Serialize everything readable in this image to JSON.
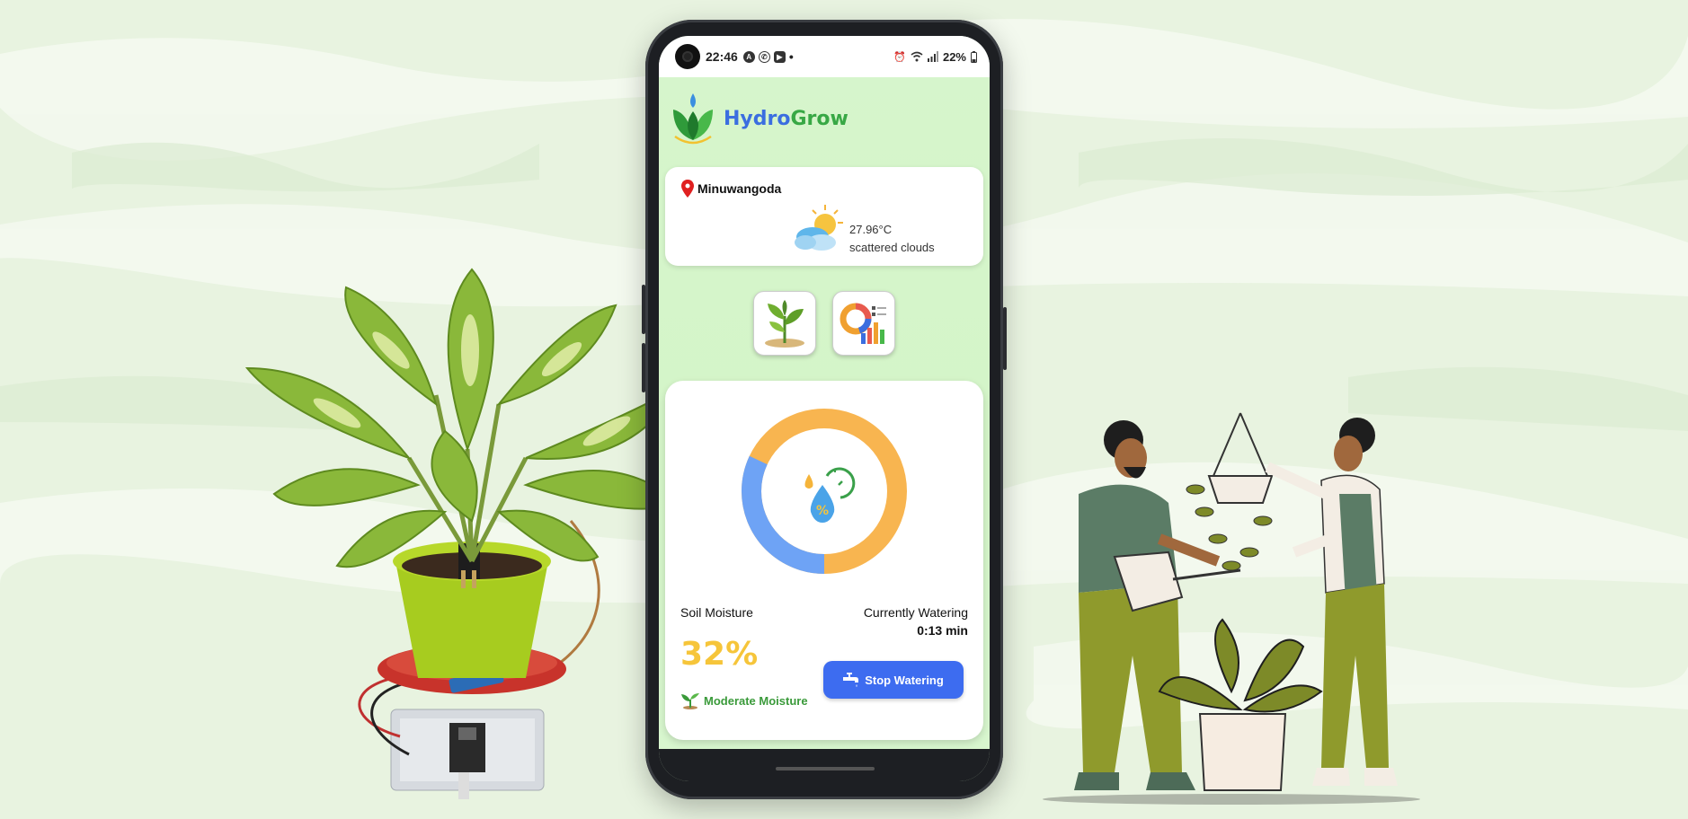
{
  "status_bar": {
    "time": "22:46",
    "battery": "22%",
    "left_icons": [
      "a-icon",
      "whatsapp-icon",
      "youtube-icon",
      "dot"
    ],
    "right_icons": [
      "alarm-icon",
      "wifi-icon",
      "signal-icon",
      "battery-icon"
    ]
  },
  "app": {
    "title_part1": "Hydro",
    "title_part2": "Grow",
    "brand_blue": "#3b6ee0",
    "brand_green": "#38a845"
  },
  "weather": {
    "location": "Minuwangoda",
    "temperature": "27.96°C",
    "condition": "scattered clouds",
    "icon": "sun-cloud-icon"
  },
  "nav": {
    "items": [
      {
        "icon": "plant-icon"
      },
      {
        "icon": "chart-icon"
      }
    ]
  },
  "moisture": {
    "label": "Soil Moisture",
    "value": "32%",
    "value_fraction": 0.32,
    "status": "Moderate Moisture",
    "watering_label": "Currently Watering",
    "watering_time": "0:13 min",
    "button_label": "Stop Watering",
    "ring_colors": {
      "filled": "#6ea3f5",
      "remaining": "#f8b550"
    },
    "value_color": "#f6c53a",
    "status_color": "#3a9a3a"
  }
}
